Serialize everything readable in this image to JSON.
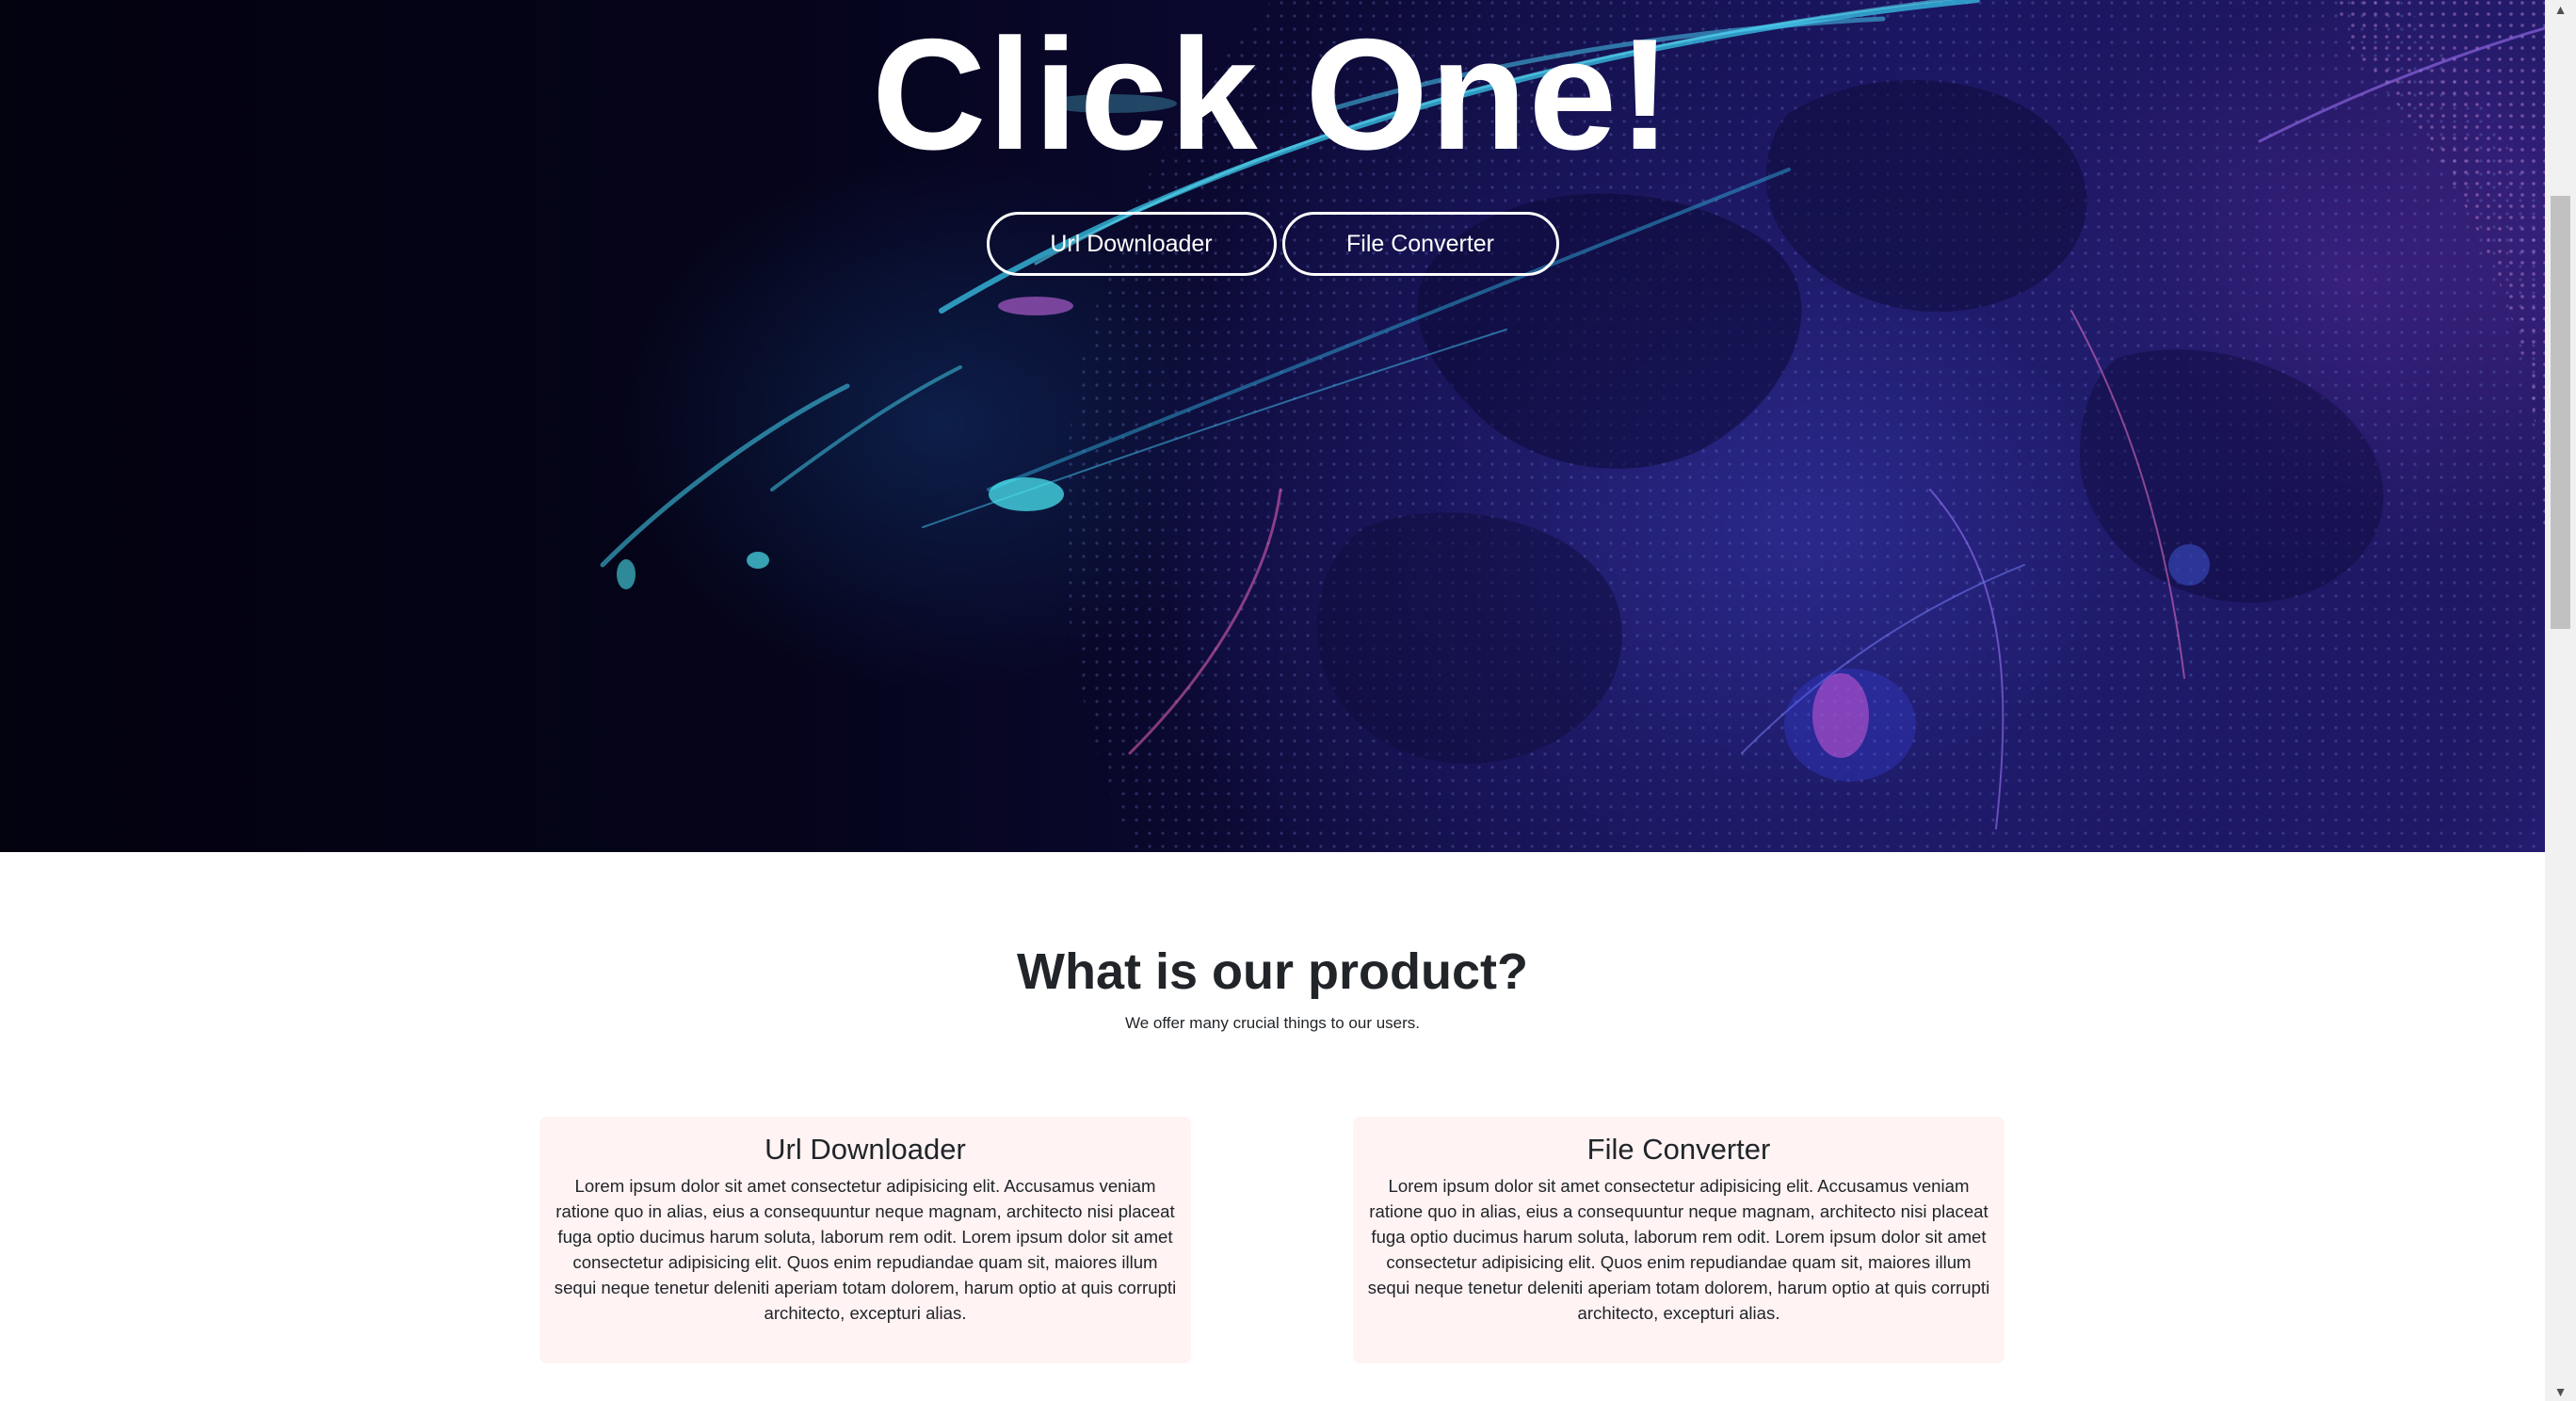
{
  "hero": {
    "title": "Click One!",
    "buttons": [
      {
        "label": "Url Downloader"
      },
      {
        "label": "File Converter"
      }
    ]
  },
  "product": {
    "title": "What is our product?",
    "subtitle": "We offer many crucial things to our users.",
    "cards": [
      {
        "title": "Url Downloader",
        "body": "Lorem ipsum dolor sit amet consectetur adipisicing elit. Accusamus veniam ratione quo in alias, eius a consequuntur neque magnam, architecto nisi placeat fuga optio ducimus harum soluta, laborum rem odit. Lorem ipsum dolor sit amet consectetur adipisicing elit. Quos enim repudiandae quam sit, maiores illum sequi neque tenetur deleniti aperiam totam dolorem, harum optio at quis corrupti architecto, excepturi alias."
      },
      {
        "title": "File Converter",
        "body": "Lorem ipsum dolor sit amet consectetur adipisicing elit. Accusamus veniam ratione quo in alias, eius a consequuntur neque magnam, architecto nisi placeat fuga optio ducimus harum soluta, laborum rem odit. Lorem ipsum dolor sit amet consectetur adipisicing elit. Quos enim repudiandae quam sit, maiores illum sequi neque tenetur deleniti aperiam totam dolorem, harum optio at quis corrupti architecto, excepturi alias."
      }
    ]
  },
  "scrollbar": {
    "up_icon": "chevron-up-icon",
    "down_icon": "chevron-down-icon"
  },
  "colors": {
    "hero_bg": "#05041a",
    "hero_text": "#ffffff",
    "card_bg": "#fff3f3",
    "text": "#212529"
  }
}
